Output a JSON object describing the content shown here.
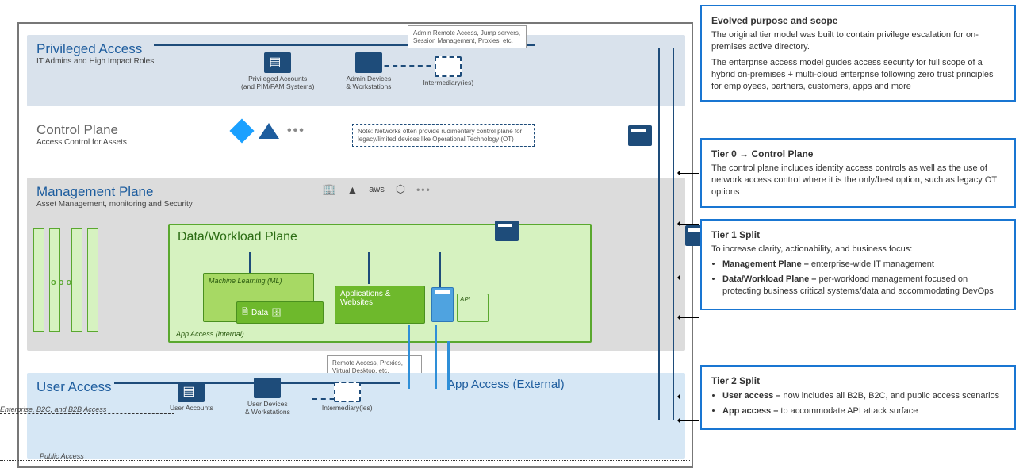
{
  "planes": {
    "privileged": {
      "title": "Privileged Access",
      "subtitle": "IT Admins and High Impact Roles",
      "items": [
        {
          "label": "Privileged Accounts\n(and PIM/PAM Systems)"
        },
        {
          "label": "Admin Devices\n& Workstations"
        },
        {
          "label": "Intermediary(ies)"
        }
      ],
      "callout": "Admin Remote Access, Jump servers, Session Management, Proxies, etc."
    },
    "control": {
      "title": "Control Plane",
      "subtitle": "Access Control for Assets",
      "note": "Note: Networks often provide rudimentary control plane for legacy/limited devices like Operational Technology (OT)"
    },
    "mgmt": {
      "title": "Management Plane",
      "subtitle": "Asset Management, monitoring and Security"
    },
    "workload": {
      "title": "Data/Workload Plane",
      "ml_label": "Machine Learning (ML)",
      "data_label": "Data",
      "apps_label": "Applications & Websites",
      "api_label": "API",
      "app_access_internal": "App Access (Internal)"
    },
    "user": {
      "title": "User Access",
      "items": [
        {
          "label": "User Accounts"
        },
        {
          "label": "User Devices\n& Workstations"
        },
        {
          "label": "Intermediary(ies)"
        }
      ],
      "enterprise_label": "Enterprise, B2C, and B2B Access",
      "public_label": "Public Access",
      "callout": "Remote Access, Proxies, Virtual Desktop, etc."
    },
    "app_access_external": "App Access (External)"
  },
  "icons": {
    "mgmt_providers": [
      "building-icon",
      "azure-icon",
      "aws-icon",
      "polygon-icon",
      "more"
    ]
  },
  "annotations": [
    {
      "title": "Evolved purpose and scope",
      "paragraphs": [
        "The original tier model was built to contain privilege escalation for on-premises active directory.",
        "The enterprise access model guides access security for full scope of a hybrid on-premises + multi-cloud enterprise following zero trust principles for employees, partners, customers, apps and more"
      ],
      "list": []
    },
    {
      "title": "Tier 0 → Control Plane",
      "paragraphs": [
        "The control plane includes identity access controls as well as the use of network access control where it is the only/best option, such as legacy OT options"
      ],
      "list": []
    },
    {
      "title": "Tier 1 Split",
      "paragraphs": [
        "To increase clarity, actionability, and business focus:"
      ],
      "list": [
        "<b>Management Plane –</b> enterprise-wide IT management",
        "<b>Data/Workload Plane –</b> per-workload management focused on protecting business critical systems/data and accommodating DevOps"
      ]
    },
    {
      "title": "Tier 2 Split",
      "paragraphs": [],
      "list": [
        "<b>User access –</b> now includes all B2B, B2C, and public access scenarios",
        "<b>App access –</b> to accommodate API attack surface"
      ]
    }
  ]
}
